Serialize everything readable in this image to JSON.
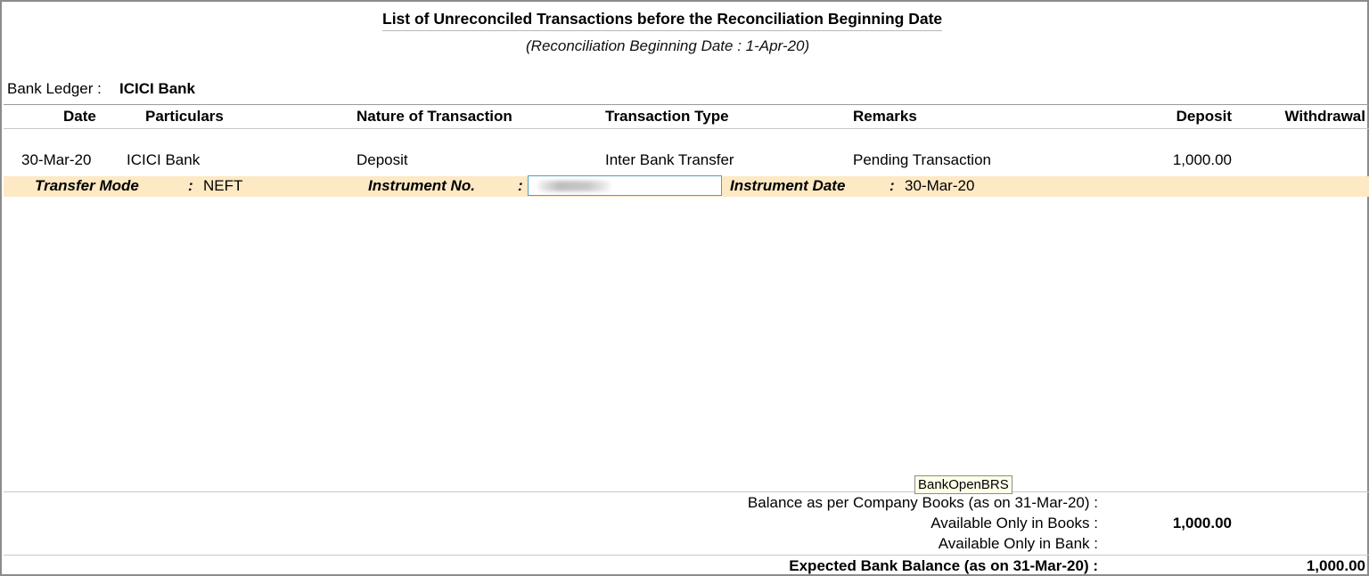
{
  "report": {
    "title": "List of Unreconciled Transactions before the Reconciliation Beginning Date",
    "subtitle": "(Reconciliation Beginning Date :  1-Apr-20)"
  },
  "ledger": {
    "label": "Bank Ledger :",
    "value": "ICICI Bank"
  },
  "columns": {
    "date": "Date",
    "particulars": "Particulars",
    "nature": "Nature of Transaction",
    "type": "Transaction Type",
    "remarks": "Remarks",
    "deposit": "Deposit",
    "withdrawal": "Withdrawal"
  },
  "rows": [
    {
      "date": "30-Mar-20",
      "particulars": "ICICI Bank",
      "nature": "Deposit",
      "type": "Inter Bank Transfer",
      "remarks": "Pending Transaction",
      "deposit": "1,000.00",
      "withdrawal": "",
      "details": {
        "transfer_mode_label": "Transfer Mode",
        "transfer_mode_value": "NEFT",
        "instrument_no_label": "Instrument No.",
        "instrument_no_value": "",
        "instrument_date_label": "Instrument Date",
        "instrument_date_value": "30-Mar-20",
        "separator": ":"
      }
    }
  ],
  "tooltip": "BankOpenBRS",
  "footer": {
    "balance_books_label": "Balance as per Company Books (as on 31-Mar-20) :",
    "only_books_label": "Available Only in Books :",
    "only_books_value": "1,000.00",
    "only_bank_label": "Available Only in Bank :",
    "expected_label": "Expected Bank Balance (as on 31-Mar-20) :",
    "expected_value": "1,000.00"
  },
  "colors": {
    "highlight_band": "#fde9c4",
    "focus_border": "#4aa3b8",
    "frame_border": "#8c8c8c"
  }
}
